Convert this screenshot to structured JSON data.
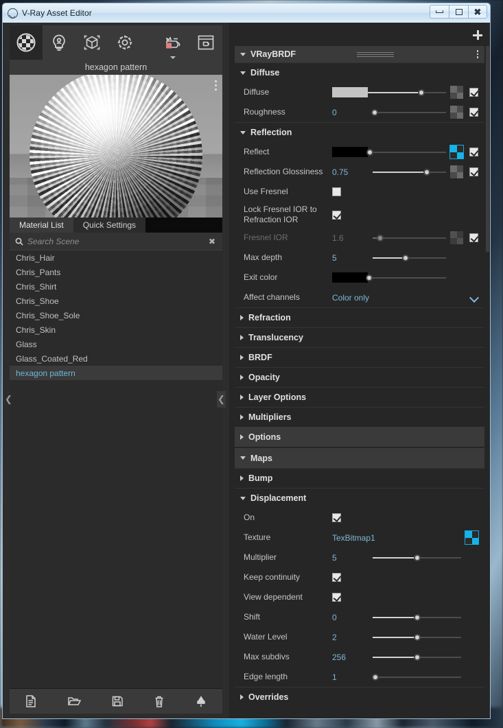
{
  "window": {
    "title": "V-Ray Asset Editor",
    "icon": "vray-checkmark-icon",
    "buttons": {
      "minimize": "minimize-icon",
      "maximize": "maximize-icon",
      "close": "close-icon"
    }
  },
  "toolbar": {
    "items": [
      {
        "id": "materials",
        "icon": "checkered-sphere-icon",
        "label": "Materials",
        "active": true
      },
      {
        "id": "lights",
        "icon": "light-bulb-icon",
        "label": "Lights",
        "active": false
      },
      {
        "id": "geometry",
        "icon": "cube-icon",
        "label": "Geometry",
        "active": false
      },
      {
        "id": "settings",
        "icon": "gear-icon",
        "label": "Settings",
        "active": false
      },
      {
        "id": "render-preview",
        "icon": "teapot-icon",
        "label": "Render Preview",
        "active": false
      },
      {
        "id": "render-window",
        "icon": "render-window-icon",
        "label": "Render Window",
        "active": false
      }
    ]
  },
  "preview": {
    "title": "hexagon pattern",
    "menu_icon": "vertical-dots-icon"
  },
  "tabs": [
    {
      "label": "Material List",
      "active": true
    },
    {
      "label": "Quick Settings",
      "active": false
    }
  ],
  "search": {
    "placeholder": "Search Scene",
    "value": "",
    "icon": "search-icon",
    "clear_icon": "clear-x-icon"
  },
  "material_list": [
    {
      "name": "Chris_Hair",
      "selected": false
    },
    {
      "name": "Chris_Pants",
      "selected": false
    },
    {
      "name": "Chris_Shirt",
      "selected": false
    },
    {
      "name": "Chris_Shoe",
      "selected": false
    },
    {
      "name": "Chris_Shoe_Sole",
      "selected": false
    },
    {
      "name": "Chris_Skin",
      "selected": false
    },
    {
      "name": "Glass",
      "selected": false
    },
    {
      "name": "Glass_Coated_Red",
      "selected": false
    },
    {
      "name": "hexagon pattern",
      "selected": true
    }
  ],
  "bottom_toolbar": [
    {
      "id": "new-asset",
      "icon": "document-icon"
    },
    {
      "id": "open-asset",
      "icon": "folder-open-icon"
    },
    {
      "id": "save-asset",
      "icon": "floppy-disk-icon"
    },
    {
      "id": "delete-asset",
      "icon": "trash-icon"
    },
    {
      "id": "purge-asset",
      "icon": "purge-icon"
    }
  ],
  "collapse": {
    "left_chevron": "chevron-left-icon",
    "divider_chevron": "chevron-left-icon"
  },
  "right_panel": {
    "add_label": "+",
    "brdf": {
      "title": "VRayBRDF",
      "grip_icon": "drag-grip-icon",
      "menu_icon": "vertical-dots-icon"
    },
    "sections": {
      "diffuse": {
        "title": "Diffuse",
        "expanded": true,
        "rows": [
          {
            "label": "Diffuse",
            "type": "color",
            "color": "#c4c4c4",
            "slider": 68,
            "slot": "grey",
            "checked": true
          },
          {
            "label": "Roughness",
            "type": "number",
            "value": "0",
            "slider": 3,
            "slot": "grey",
            "checked": true
          }
        ]
      },
      "reflection": {
        "title": "Reflection",
        "expanded": true,
        "rows": [
          {
            "label": "Reflect",
            "type": "color",
            "color": "#000000",
            "slider": 3,
            "slot": "blue",
            "checked": true
          },
          {
            "label": "Reflection Glossiness",
            "type": "number",
            "value": "0.75",
            "slider": 74,
            "slot": "grey",
            "checked": true
          },
          {
            "label": "Use Fresnel",
            "type": "checkbox",
            "checked": false
          },
          {
            "label": "Lock Fresnel IOR to Refraction IOR",
            "type": "checkbox",
            "checked": true
          },
          {
            "label": "Fresnel IOR",
            "type": "number",
            "value": "1.6",
            "slider": 10,
            "slot": "grey",
            "checked": true,
            "disabled": true
          },
          {
            "label": "Max depth",
            "type": "number",
            "value": "5",
            "slider": 45,
            "slot": "none"
          },
          {
            "label": "Exit color",
            "type": "color",
            "color": "#000000",
            "slider": 2,
            "slot": "none"
          },
          {
            "label": "Affect channels",
            "type": "dropdown",
            "value": "Color only"
          }
        ]
      },
      "collapsed_groups": [
        {
          "title": "Refraction",
          "expanded": false,
          "boxed": false
        },
        {
          "title": "Translucency",
          "expanded": false,
          "boxed": false
        },
        {
          "title": "BRDF",
          "expanded": false,
          "boxed": false
        },
        {
          "title": "Opacity",
          "expanded": false,
          "boxed": false
        },
        {
          "title": "Layer Options",
          "expanded": false,
          "boxed": false
        },
        {
          "title": "Multipliers",
          "expanded": false,
          "boxed": false
        },
        {
          "title": "Options",
          "expanded": false,
          "boxed": true
        }
      ],
      "maps": {
        "title": "Maps",
        "expanded": true,
        "boxed": true
      },
      "bump": {
        "title": "Bump",
        "expanded": false,
        "boxed": false
      },
      "displacement": {
        "title": "Displacement",
        "expanded": true,
        "rows": [
          {
            "label": "On",
            "type": "checkbox",
            "checked": true
          },
          {
            "label": "Texture",
            "type": "texture",
            "value": "TexBitmap1",
            "slot": "blue"
          },
          {
            "label": "Multiplier",
            "type": "number",
            "value": "5",
            "slider": 50
          },
          {
            "label": "Keep continuity",
            "type": "checkbox",
            "checked": true
          },
          {
            "label": "View dependent",
            "type": "checkbox",
            "checked": true
          },
          {
            "label": "Shift",
            "type": "number",
            "value": "0",
            "slider": 50
          },
          {
            "label": "Water Level",
            "type": "number",
            "value": "2",
            "slider": 50
          },
          {
            "label": "Max subdivs",
            "type": "number",
            "value": "256",
            "slider": 50
          },
          {
            "label": "Edge length",
            "type": "number",
            "value": "1",
            "slider": 3
          }
        ]
      },
      "overrides": {
        "title": "Overrides",
        "expanded": false,
        "boxed": false
      }
    }
  },
  "colors": {
    "accent_blue": "#7fb8d4",
    "slot_blue": "#14b4ea",
    "panel_bg": "#262626",
    "left_bg": "#2d2d2d",
    "header_bg": "#3a3a3a"
  }
}
